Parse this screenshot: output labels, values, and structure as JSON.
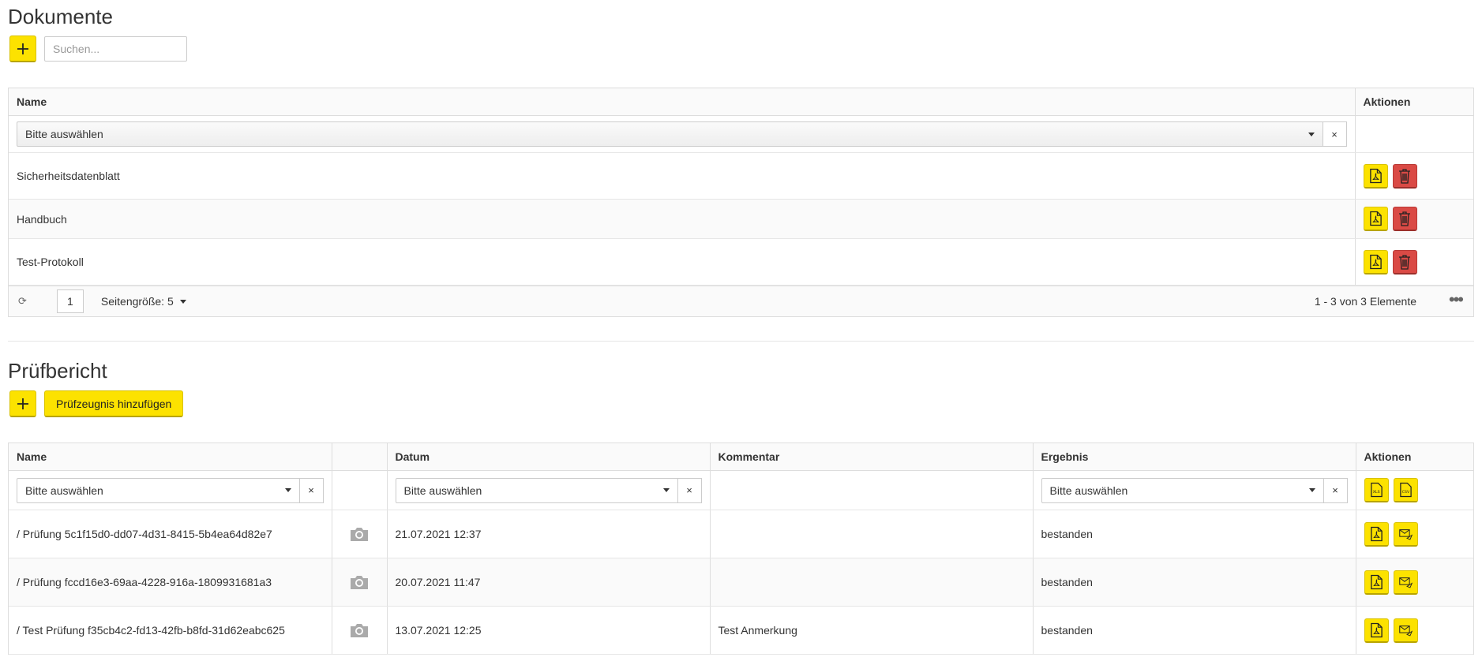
{
  "documents": {
    "title": "Dokumente",
    "search_placeholder": "Suchen...",
    "columns": {
      "name": "Name",
      "actions": "Aktionen"
    },
    "filter_placeholder": "Bitte auswählen",
    "filter_clear": "×",
    "rows": [
      {
        "name": "Sicherheitsdatenblatt"
      },
      {
        "name": "Handbuch"
      },
      {
        "name": "Test-Protokoll"
      }
    ],
    "pager": {
      "page": "1",
      "page_size_label": "Seitengröße: 5",
      "info": "1 - 3 von 3 Elemente"
    }
  },
  "report": {
    "title": "Prüfbericht",
    "add_label": "Prüfzeugnis hinzufügen",
    "columns": {
      "name": "Name",
      "photo": "",
      "date": "Datum",
      "comment": "Kommentar",
      "result": "Ergebnis",
      "actions": "Aktionen"
    },
    "filter_placeholder": "Bitte auswählen",
    "filter_clear": "×",
    "rows": [
      {
        "name": "/ Prüfung 5c1f15d0-dd07-4d31-8415-5b4ea64d82e7",
        "date": "21.07.2021 12:37",
        "comment": "",
        "result": "bestanden"
      },
      {
        "name": "/ Prüfung fccd16e3-69aa-4228-916a-1809931681a3",
        "date": "20.07.2021 11:47",
        "comment": "",
        "result": "bestanden"
      },
      {
        "name": "/ Test Prüfung f35cb4c2-fd13-42fb-b8fd-31d62eabc625",
        "date": "13.07.2021 12:25",
        "comment": "Test Anmerkung",
        "result": "bestanden"
      }
    ]
  },
  "colors": {
    "accent": "#fce200",
    "danger": "#da4a45"
  },
  "icons": [
    "plus-icon",
    "pdf-icon",
    "trash-icon",
    "excel-export-icon",
    "csv-export-icon",
    "camera-icon",
    "mail-send-icon",
    "refresh-icon",
    "caret-down-icon",
    "more-icon"
  ]
}
